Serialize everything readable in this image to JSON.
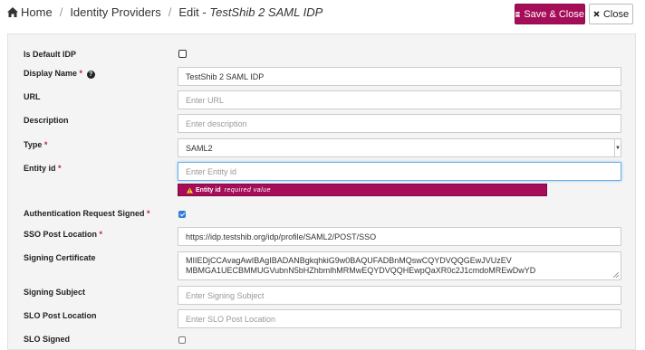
{
  "breadcrumb": {
    "home": "Home",
    "section": "Identity Providers",
    "edit_prefix": "Edit - ",
    "edit_name": "TestShib 2 SAML IDP"
  },
  "toolbar": {
    "save_close_label": "Save & Close",
    "close_label": "Close"
  },
  "form": {
    "is_default_label": "Is Default IDP",
    "display_name_label": "Display Name",
    "display_name_value": "TestShib 2 SAML IDP",
    "url_label": "URL",
    "url_placeholder": "Enter URL",
    "description_label": "Description",
    "description_placeholder": "Enter description",
    "type_label": "Type",
    "type_value": "SAML2",
    "entity_id_label": "Entity id",
    "entity_id_placeholder": "Enter Entity id",
    "entity_id_error_field": "Entity id",
    "entity_id_error_msg": "required value",
    "auth_signed_label": "Authentication Request Signed",
    "sso_post_label": "SSO Post Location",
    "sso_post_value": "https://idp.testshib.org/idp/profile/SAML2/POST/SSO",
    "signing_cert_label": "Signing Certificate",
    "signing_cert_line1": "MIIEDjCCAvagAwIBAgIBADANBgkqhkiG9w0BAQUFADBnMQswCQYDVQQGEwJVUzEV",
    "signing_cert_line2": "MBMGA1UECBMMUGVubnN5bHZhbmlhMRMwEQYDVQQHEwpQaXR0c2J1cmdoMREwDwYD",
    "signing_subject_label": "Signing Subject",
    "signing_subject_placeholder": "Enter Signing Subject",
    "slo_post_label": "SLO Post Location",
    "slo_post_placeholder": "Enter SLO Post Location",
    "slo_signed_label": "SLO Signed",
    "required_mark": "*"
  },
  "colors": {
    "accent": "#a50d59",
    "focus": "#66afe9",
    "checkbox_checked": "#2f7ed8"
  },
  "icons": [
    "home-icon",
    "save-icon",
    "close-icon",
    "help-icon",
    "warning-icon",
    "chevron-down-icon"
  ]
}
